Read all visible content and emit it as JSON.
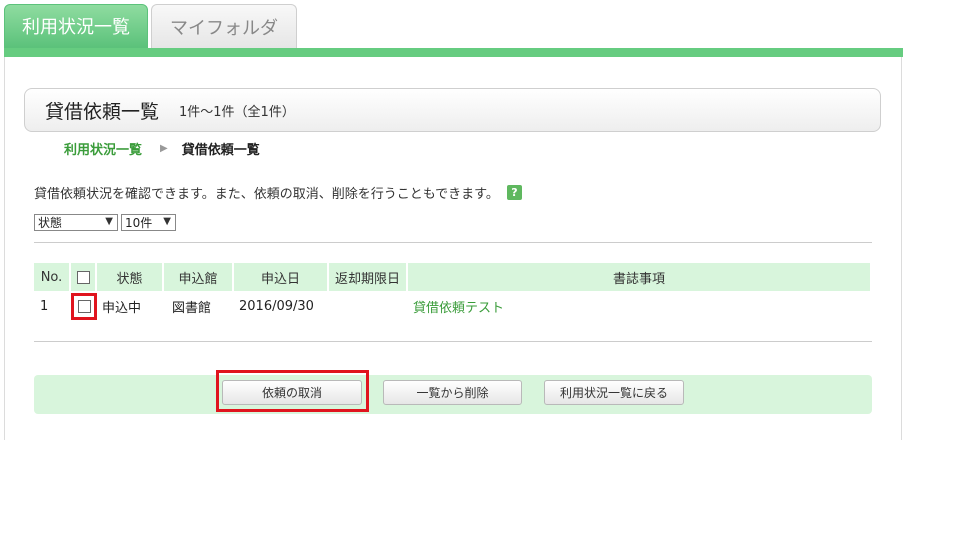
{
  "tabs": {
    "usage_list": "利用状況一覧",
    "my_folder": "マイフォルダ"
  },
  "title": {
    "main": "貸借依頼一覧",
    "count": "1件～1件（全1件）"
  },
  "breadcrumb": {
    "parent": "利用状況一覧",
    "separator": "▶",
    "current": "貸借依頼一覧"
  },
  "description": "貸借依頼状況を確認できます。また、依頼の取消、削除を行うこともできます。",
  "help_icon": "?",
  "filters": {
    "status_select": "状態",
    "count_select": "10件"
  },
  "table": {
    "headers": [
      "No.",
      "",
      "状態",
      "申込館",
      "申込日",
      "返却期限日",
      "書誌事項"
    ],
    "rows": [
      {
        "no": "1",
        "checked": false,
        "status": "申込中",
        "library": "図書館",
        "date": "2016/09/30",
        "due": "",
        "title": "貸借依頼テスト"
      }
    ]
  },
  "buttons": {
    "cancel": "依頼の取消",
    "delete": "一覧から削除",
    "back": "利用状況一覧に戻る"
  },
  "colors": {
    "accent_green": "#66cc80",
    "header_green": "#d8f5dc",
    "link_green": "#3a9c3a",
    "highlight_red": "#e0141e"
  }
}
